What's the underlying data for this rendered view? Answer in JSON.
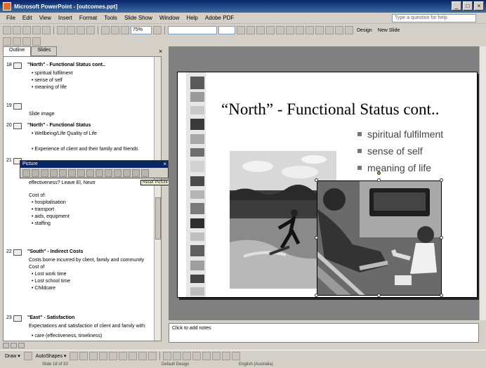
{
  "window": {
    "title": "Microsoft PowerPoint - [outcomes.ppt]",
    "controls": [
      "_",
      "□",
      "×"
    ]
  },
  "menubar": {
    "items": [
      "File",
      "Edit",
      "View",
      "Insert",
      "Format",
      "Tools",
      "Slide Show",
      "Window",
      "Help",
      "Adobe PDF"
    ],
    "help_placeholder": "Type a question for help"
  },
  "toolbar": {
    "zoom": "75%",
    "design_label": "Design",
    "new_slide_label": "New Slide"
  },
  "outline_pane": {
    "tabs": [
      "Outline",
      "Slides"
    ],
    "slides": [
      {
        "num": "18",
        "title": "\"North\" - Functional Status cont..",
        "bullets": [
          "spiritual fulfilment",
          "sense of self",
          "meaning of life"
        ]
      },
      {
        "num": "19",
        "title": "",
        "bullets": [
          "Slide image"
        ]
      },
      {
        "num": "20",
        "title": "\"North\" - Functional Status",
        "bullets": [
          "Wellbeing/Life Quality of Life",
          "Experience of client and their family and friends"
        ]
      },
      {
        "num": "21",
        "title": "",
        "bullets": [
          "effectiveness?    Leave El, Neutr",
          "Cost of:",
          "hospitalisation",
          "transport",
          "aids, equipment",
          "staffing"
        ]
      },
      {
        "num": "22",
        "title": "\"South\" - Indirect Costs",
        "bullets": [
          "Costs borne incurred by client, family and community",
          "Cost of",
          "Lost work time",
          "Lost school time",
          "Childcare"
        ]
      },
      {
        "num": "23",
        "title": "\"East\" - Satisfaction",
        "bullets": [
          "Expectations and satisfaction of client and family with:",
          "care (effectiveness, timeliness)"
        ]
      }
    ]
  },
  "picture_toolbar": {
    "title": "Picture",
    "close": "×",
    "tooltip": "Reset Picture"
  },
  "slide": {
    "title": "“North” - Functional Status cont..",
    "bullets": [
      "spiritual fulfilment",
      "sense of self",
      "meaning of life"
    ]
  },
  "notes": {
    "placeholder": "Click to add notes"
  },
  "drawbar": {
    "draw_label": "Draw ▾",
    "autoshapes_label": "AutoShapes ▾"
  },
  "statusbar": {
    "slide": "Slide 18 of 33",
    "design": "Default Design",
    "language": "English (Australia)"
  },
  "colors": {
    "titlebar": "#0a246a",
    "app_accent": "#e66b25",
    "slide_bg": "#ffffff",
    "workspace": "#808080"
  }
}
